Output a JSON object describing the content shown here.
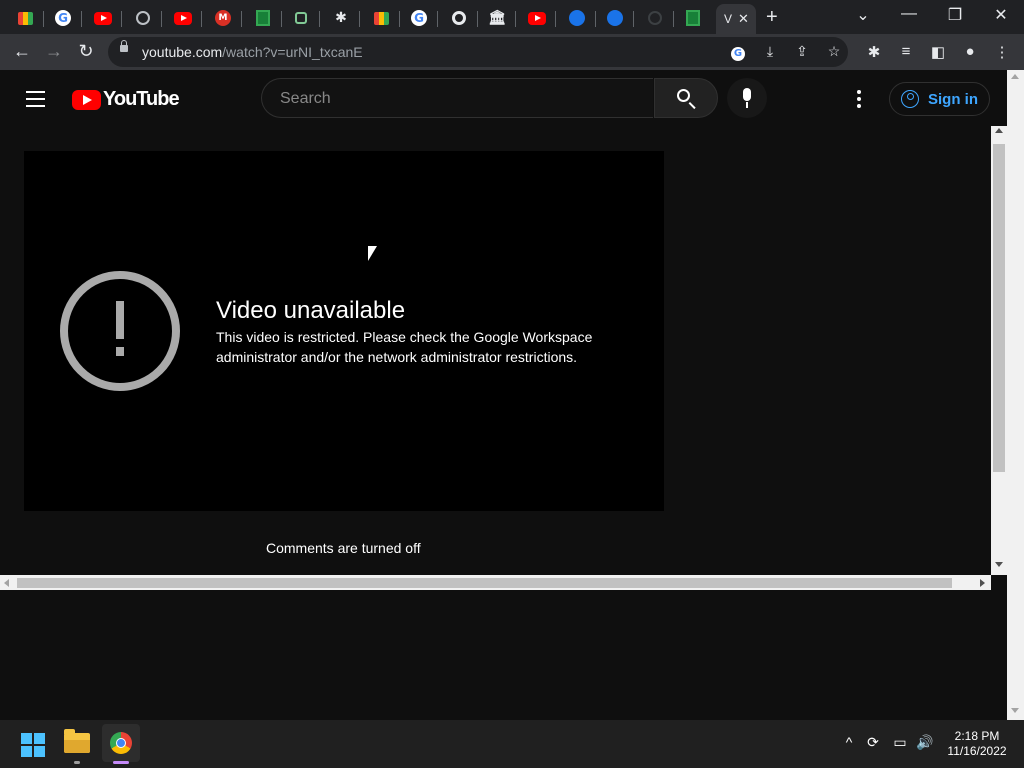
{
  "browser": {
    "active_tab_title": "V",
    "address": {
      "host": "youtube.com",
      "path": "/watch?v=urNI_txcanE"
    },
    "colors": {
      "tab_strip": "#202124",
      "toolbar": "#35363a"
    }
  },
  "youtube": {
    "logo_text": "YouTube",
    "search_placeholder": "Search",
    "sign_in_label": "Sign in",
    "error": {
      "title": "Video unavailable",
      "message": "This video is restricted. Please check the Google Workspace administrator and/or the network administrator restrictions."
    },
    "comments_status": "Comments are turned off",
    "colors": {
      "brand_red": "#ff0000",
      "link_blue": "#3ea6ff",
      "background": "#0f0f0f"
    }
  },
  "taskbar": {
    "time": "2:18 PM",
    "date": "11/16/2022"
  }
}
